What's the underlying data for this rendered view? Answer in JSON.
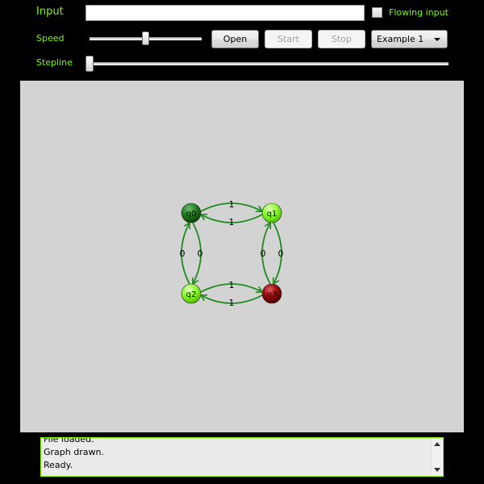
{
  "header": {
    "input_label": "Input",
    "input_value": "",
    "flowing_label": "Flowing input",
    "flowing_checked": false,
    "speed_label": "Speed",
    "speed_level": 0.5,
    "stepline_label": "Stepline",
    "stepline_level": 0.0
  },
  "buttons": {
    "open": "Open",
    "start": "Start",
    "stop": "Stop"
  },
  "example_select": {
    "selected": "Example 1"
  },
  "colors": {
    "label_green": "#7CFC00",
    "edge_green": "#1e8a1e",
    "canvas_bg": "#d3d3d3"
  },
  "graph": {
    "states": [
      {
        "id": "q0",
        "label": "q0",
        "style": "dark-green"
      },
      {
        "id": "q1",
        "label": "q1",
        "style": "light-green"
      },
      {
        "id": "q2",
        "label": "q2",
        "style": "light-green"
      },
      {
        "id": "q3",
        "label": "q3",
        "style": "red"
      }
    ],
    "edges": [
      {
        "from": "q0",
        "to": "q1",
        "label": "1"
      },
      {
        "from": "q1",
        "to": "q0",
        "label": "1"
      },
      {
        "from": "q2",
        "to": "q0",
        "label": "0"
      },
      {
        "from": "q0",
        "to": "q2",
        "label": "0"
      },
      {
        "from": "q3",
        "to": "q1",
        "label": "0"
      },
      {
        "from": "q1",
        "to": "q3",
        "label": "0"
      },
      {
        "from": "q2",
        "to": "q3",
        "label": "1"
      },
      {
        "from": "q3",
        "to": "q2",
        "label": "1"
      }
    ]
  },
  "log": {
    "lines": [
      "File loaded.",
      "Graph drawn.",
      "Ready."
    ]
  }
}
